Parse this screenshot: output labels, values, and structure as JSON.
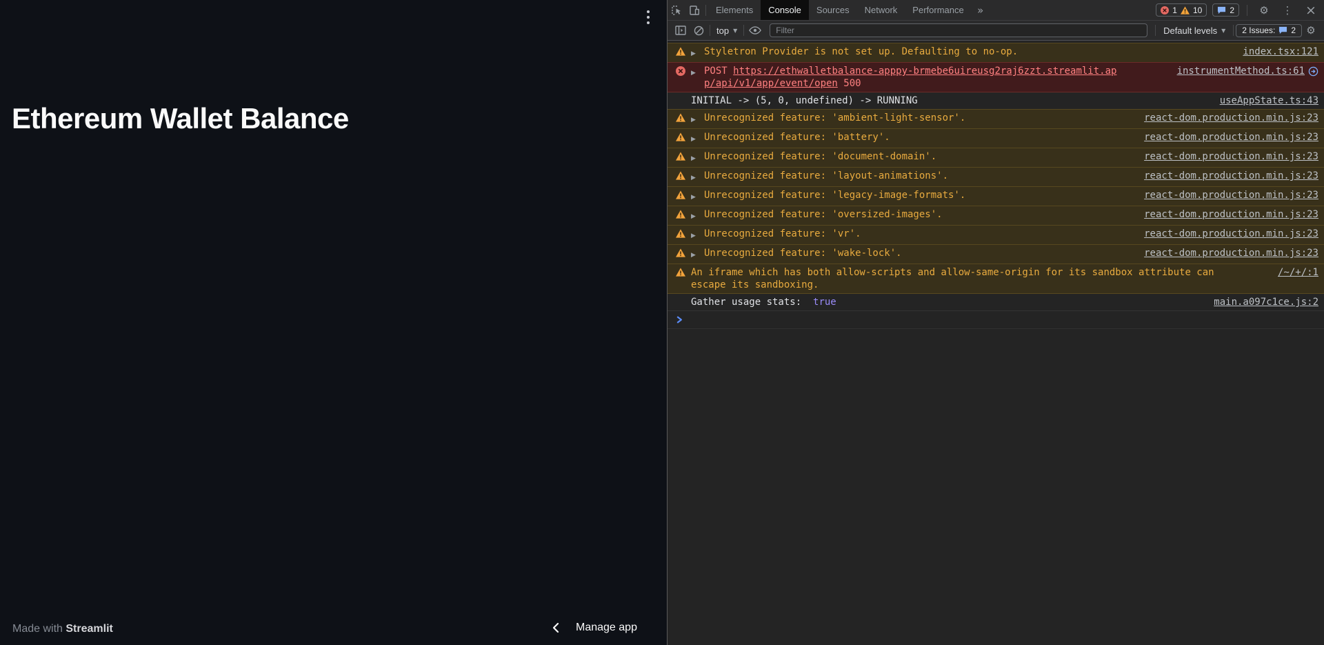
{
  "app": {
    "title": "Ethereum Wallet Balance",
    "footer_made_with": "Made with ",
    "footer_brand": "Streamlit",
    "manage_app_label": "Manage app"
  },
  "devtools": {
    "tabs": [
      {
        "label": "Elements",
        "active": false
      },
      {
        "label": "Console",
        "active": true
      },
      {
        "label": "Sources",
        "active": false
      },
      {
        "label": "Network",
        "active": false
      },
      {
        "label": "Performance",
        "active": false
      }
    ],
    "more_tabs_glyph": "»",
    "error_count": "1",
    "warning_count": "10",
    "message_count": "2",
    "close_glyph": "×",
    "kebab_glyph": "⋮",
    "gear_glyph": "⚙",
    "caret_glyph": "▼",
    "expand_glyph": "▶",
    "toolbar": {
      "context_selector": "top",
      "filter_placeholder": "Filter",
      "levels_label": "Default levels",
      "issues_label": "2 Issues:",
      "issues_count": "2"
    },
    "colors": {
      "accent_blue": "#8ab4f8",
      "error_red": "#e46962",
      "warning_orange": "#f2a33c",
      "boolean_purple": "#9a8cfa",
      "warn_text": "#e9ab3f",
      "error_text": "#ff8080"
    },
    "messages": [
      {
        "level": "warn",
        "expandable": true,
        "text": "Styletron Provider is not set up. Defaulting to no-op.",
        "source": "index.tsx:121"
      },
      {
        "level": "error",
        "expandable": true,
        "prefix": "POST ",
        "link_lines": [
          "https://ethwalletbalance-apppy-brmebe6uireusg2raj6zzt.streamlit.ap",
          "p/api/v1/app/event/open"
        ],
        "suffix": " 500",
        "source": "instrumentMethod.ts:61",
        "initiator_icon": true
      },
      {
        "level": "log",
        "text": "INITIAL -> (5, 0, undefined) -> RUNNING",
        "source": "useAppState.ts:43"
      },
      {
        "level": "warn",
        "expandable": true,
        "text": "Unrecognized feature: 'ambient-light-sensor'.",
        "source": "react-dom.production.min.js:23"
      },
      {
        "level": "warn",
        "expandable": true,
        "text": "Unrecognized feature: 'battery'.",
        "source": "react-dom.production.min.js:23"
      },
      {
        "level": "warn",
        "expandable": true,
        "text": "Unrecognized feature: 'document-domain'.",
        "source": "react-dom.production.min.js:23"
      },
      {
        "level": "warn",
        "expandable": true,
        "text": "Unrecognized feature: 'layout-animations'.",
        "source": "react-dom.production.min.js:23"
      },
      {
        "level": "warn",
        "expandable": true,
        "text": "Unrecognized feature: 'legacy-image-formats'.",
        "source": "react-dom.production.min.js:23"
      },
      {
        "level": "warn",
        "expandable": true,
        "text": "Unrecognized feature: 'oversized-images'.",
        "source": "react-dom.production.min.js:23"
      },
      {
        "level": "warn",
        "expandable": true,
        "text": "Unrecognized feature: 'vr'.",
        "source": "react-dom.production.min.js:23"
      },
      {
        "level": "warn",
        "expandable": true,
        "text": "Unrecognized feature: 'wake-lock'.",
        "source": "react-dom.production.min.js:23"
      },
      {
        "level": "warn",
        "expandable": false,
        "text_lines": [
          "An iframe which has both allow-scripts and allow-same-origin for its sandbox attribute can",
          "escape its sandboxing."
        ],
        "source": "/~/+/:1"
      },
      {
        "level": "log",
        "text": "Gather usage stats:  ",
        "value": "true",
        "source": "main.a097c1ce.js:2"
      }
    ]
  }
}
